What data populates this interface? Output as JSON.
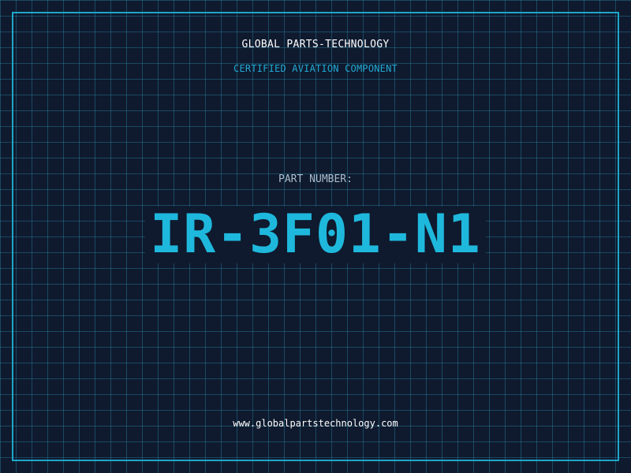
{
  "header": {
    "company": "GLOBAL PARTS-TECHNOLOGY",
    "subtitle": "CERTIFIED AVIATION COMPONENT"
  },
  "part": {
    "label": "PART NUMBER:",
    "number": "IR-3F01-N1"
  },
  "footer": {
    "url": "www.globalpartstechnology.com"
  },
  "colors": {
    "background": "#0f1a2e",
    "grid": "#2882a0",
    "accent": "#1fa7c9",
    "part_number": "#1fb8dd"
  }
}
